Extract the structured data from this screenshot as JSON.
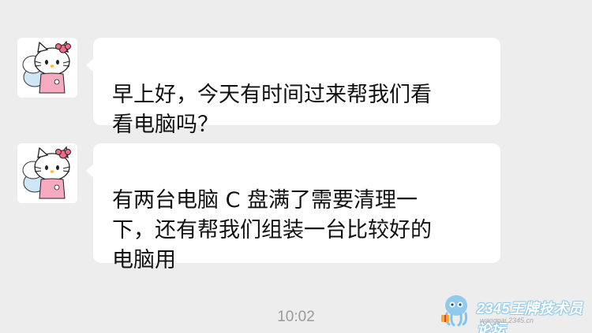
{
  "chat": {
    "messages": [
      {
        "text": "早上好，今天有时间过来帮我们看\n看电脑吗？"
      },
      {
        "text": "有两台电脑 C 盘满了需要清理一\n下，还有帮我们组装一台比较好的\n电脑用"
      }
    ],
    "timestamp": "10:02"
  },
  "watermark": {
    "title": "2345王牌技术员论坛",
    "url": "wangpai.2345.cn"
  },
  "colors": {
    "background": "#ededed",
    "bubble": "#ffffff",
    "text": "#111111",
    "timestamp": "#9a9a9a",
    "avatar_icon": "hello-kitty-avatar"
  }
}
